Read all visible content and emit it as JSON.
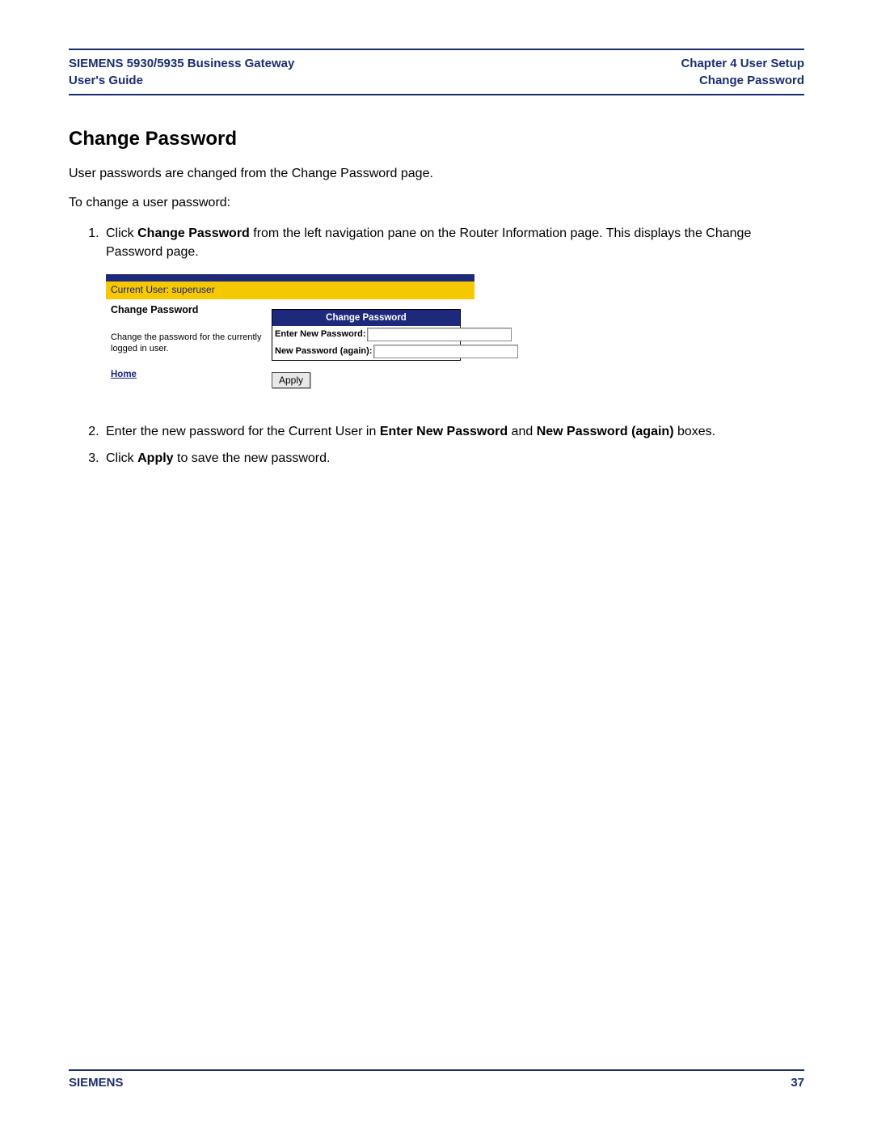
{
  "header": {
    "left_line1": "SIEMENS 5930/5935 Business Gateway",
    "left_line2": "User's Guide",
    "right_line1": "Chapter 4  User Setup",
    "right_line2": "Change Password"
  },
  "title": "Change Password",
  "intro1": "User passwords are changed from the Change Password page.",
  "intro2": "To change a user password:",
  "steps": {
    "s1a": "Click ",
    "s1b": "Change Password",
    "s1c": " from the left navigation pane on the Router Information page. This displays the Change Password page.",
    "s2a": "Enter the new password for the Current User in ",
    "s2b": "Enter New Password",
    "s2c": " and ",
    "s2d": "New Password (again)",
    "s2e": " boxes.",
    "s3a": "Click ",
    "s3b": "Apply",
    "s3c": " to save the new password."
  },
  "screenshot": {
    "current_user": "Current User: superuser",
    "left_title": "Change Password",
    "left_desc": "Change the password for the currently logged in user.",
    "home": "Home",
    "form_header": "Change Password",
    "label_new": "Enter New Password:",
    "label_again": "New Password (again):",
    "apply": "Apply"
  },
  "footer": {
    "brand": "SIEMENS",
    "page": "37"
  }
}
